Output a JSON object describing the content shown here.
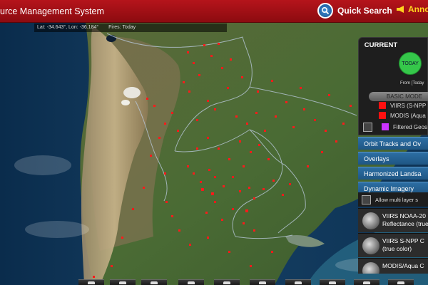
{
  "header": {
    "title": "urce Management System",
    "quick_search": "Quick Search",
    "announcements": "Annou"
  },
  "status_bar": {
    "coordinates": "Lat: -34.643°, Lon: -36.184°",
    "fires": "Fires: Today"
  },
  "panel": {
    "current_title": "CURRENT",
    "today_button": "TODAY",
    "from_text": "From [Today",
    "basic_mode": "BASIC MODE",
    "legend": [
      {
        "label": "VIIRS (S-NPP",
        "color": "#ff1010"
      },
      {
        "label": "MODIS (Aqua",
        "color": "#ff1010"
      },
      {
        "label": "Filtered Geos",
        "color": "#cc33ff"
      }
    ],
    "sections": [
      "Orbit Tracks and Ov",
      "Overlays",
      "Harmonized Landsa",
      "Dynamic Imagery"
    ],
    "allow_multi": "Allow multi layer s",
    "layers": [
      {
        "title": "VIIRS NOAA-20",
        "subtitle": "Reflectance (true"
      },
      {
        "title": "VIIRS S-NPP C",
        "subtitle": "(true color)"
      },
      {
        "title": "MODIS/Aqua C",
        "subtitle": ""
      }
    ]
  },
  "colors": {
    "header_red": "#a3111a",
    "fire_red": "#ff1a1a",
    "panel_blue": "#2468a0",
    "today_green": "#35c74a"
  },
  "toolbar": {
    "icons": [
      "pan-icon",
      "location-icon",
      "layers-icon",
      "print-icon",
      "camera-icon",
      "share-icon",
      "measure-icon",
      "person-icon",
      "grid-icon",
      "close-icon"
    ]
  }
}
